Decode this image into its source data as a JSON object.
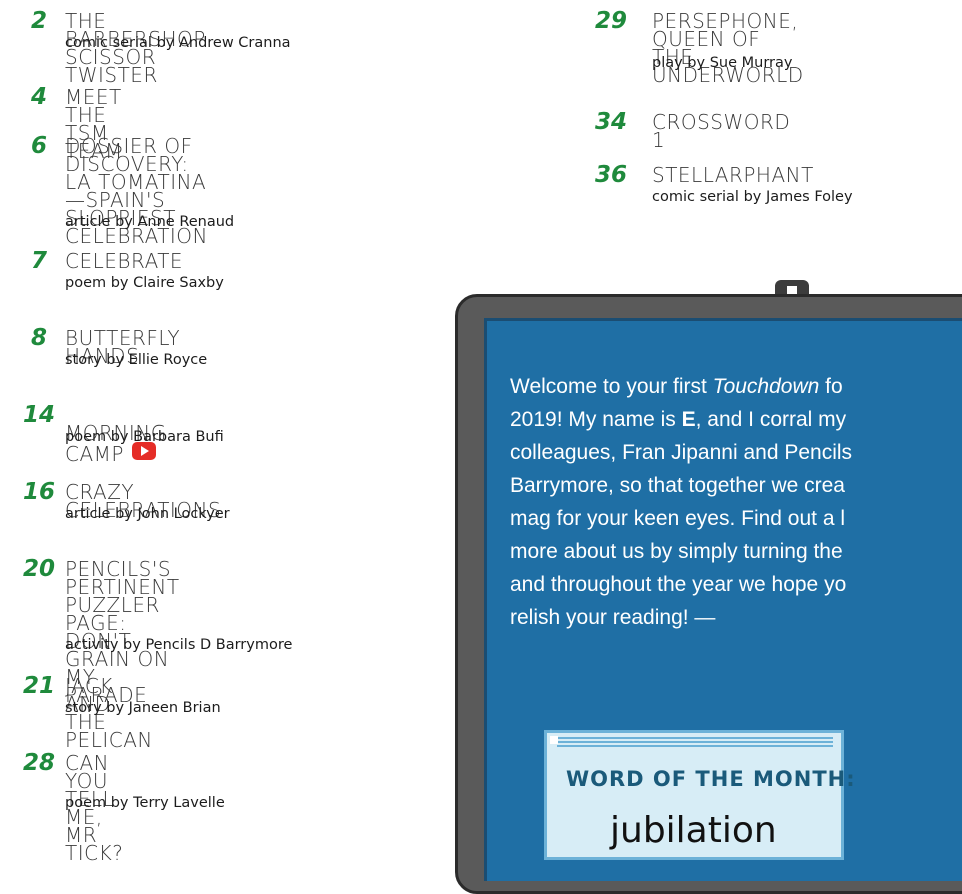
{
  "left_entries": [
    {
      "num": "2",
      "title": "THE BARBERSHOP SCISSOR TWISTER",
      "byline": "comic serial by Andrew Cranna"
    },
    {
      "num": "4",
      "title": "MEET THE TSM TEAM",
      "byline": ""
    },
    {
      "num": "6",
      "title": "DOSSIER OF DISCOVERY:\nLA TOMATINA—SPAIN'S\nSLOPPIEST CELEBRATION",
      "byline": "article by Anne Renaud"
    },
    {
      "num": "7",
      "title": "CELEBRATE",
      "byline": "poem by Claire Saxby"
    },
    {
      "num": "8",
      "title": "BUTTERFLY HANDS",
      "byline": "story by Ellie Royce"
    },
    {
      "num": "14",
      "title": "MORNING CAMP",
      "byline": "poem by Barbara Bufi",
      "video_icon": "youtube-play-icon"
    },
    {
      "num": "16",
      "title": "CRAZY CELEBRATIONS",
      "byline": "article by John Lockyer"
    },
    {
      "num": "20",
      "title": "PENCILS'S PERTINENT\nPUZZLER PAGE: DON'T\nGRAIN ON MY PARADE",
      "byline": "activity by Pencils D Barrymore"
    },
    {
      "num": "21",
      "title": "JACK AND THE PELICAN",
      "byline": "story by Janeen Brian"
    },
    {
      "num": "28",
      "title": "CAN YOU TELL ME,\nMR TICK?",
      "byline": "poem by Terry Lavelle"
    }
  ],
  "right_entries": [
    {
      "num": "29",
      "title": "PERSEPHONE, QUEEN OF\nTHE UNDERWORLD",
      "byline": "play by Sue Murray"
    },
    {
      "num": "34",
      "title": "CROSSWORD 1",
      "byline": ""
    },
    {
      "num": "36",
      "title": "STELLARPHANT",
      "byline": "comic serial by James Foley"
    }
  ],
  "board": {
    "welcome_before": "Welcome to your first ",
    "welcome_italic": "Touchdown",
    "welcome_mid1": " fo\n2019! My name is ",
    "welcome_bold": "E",
    "welcome_rest": ", and I corral my\ncolleagues, Fran Jipanni and Pencils\nBarrymore, so that together we crea\nmag for your keen eyes. Find out a l\nmore about us by simply turning the\nand throughout the year we hope yo\nrelish your reading!                  —",
    "word_label": "WORD OF THE MONTH:",
    "word": "jubilation"
  },
  "colors": {
    "number_green": "#1f8a3c",
    "board_blue": "#1f6fa5"
  }
}
